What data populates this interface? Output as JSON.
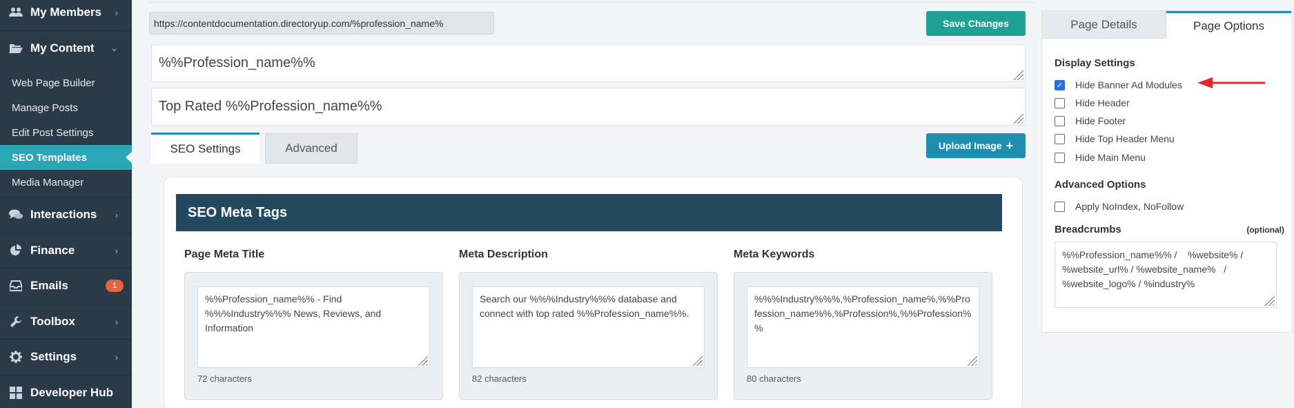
{
  "sidebar": {
    "items": [
      {
        "label": "My Members",
        "icon": "members-icon",
        "chevron": "›"
      },
      {
        "label": "My Content",
        "icon": "folder-open-icon",
        "chevron": "⌄"
      },
      {
        "label": "Interactions",
        "icon": "chat-icon",
        "chevron": "›"
      },
      {
        "label": "Finance",
        "icon": "pie-chart-icon",
        "chevron": "›"
      },
      {
        "label": "Emails",
        "icon": "inbox-icon",
        "badge": "1"
      },
      {
        "label": "Toolbox",
        "icon": "wrench-icon",
        "chevron": "›"
      },
      {
        "label": "Settings",
        "icon": "gear-icon",
        "chevron": "›"
      },
      {
        "label": "Developer Hub",
        "icon": "grid-icon"
      }
    ],
    "sub_items": [
      "Web Page Builder",
      "Manage Posts",
      "Edit Post Settings",
      "SEO Templates",
      "Media Manager"
    ],
    "active_sub": "SEO Templates"
  },
  "header": {
    "url": "https://contentdocumentation.directoryup.com/%profession_name%",
    "save_label": "Save Changes"
  },
  "fields": {
    "title_value": "%%Profession_name%%",
    "heading_value": "Top Rated %%Profession_name%%"
  },
  "tabs": {
    "seo": "SEO Settings",
    "advanced": "Advanced",
    "upload_label": "Upload Image",
    "upload_icon": "+"
  },
  "seo_meta": {
    "title": "SEO Meta Tags",
    "columns": [
      {
        "label": "Page Meta Title",
        "value": "%%Profession_name%% - Find %%%Industry%%% News, Reviews, and Information",
        "count": "72 characters"
      },
      {
        "label": "Meta Description",
        "value": "Search our %%%Industry%%% database and connect with top rated %%Profession_name%%.",
        "count": "82 characters"
      },
      {
        "label": "Meta Keywords",
        "value": "%%%Industry%%%,%Profession_name%,%%Profession_name%%,%Profession%,%%Profession%%",
        "count": "80 characters"
      }
    ]
  },
  "right_panel": {
    "tab_details": "Page Details",
    "tab_options": "Page Options",
    "display_title": "Display Settings",
    "checkboxes": [
      {
        "label": "Hide Banner Ad Modules",
        "checked": true
      },
      {
        "label": "Hide Header",
        "checked": false
      },
      {
        "label": "Hide Footer",
        "checked": false
      },
      {
        "label": "Hide Top Header Menu",
        "checked": false
      },
      {
        "label": "Hide Main Menu",
        "checked": false
      }
    ],
    "advanced_title": "Advanced Options",
    "advanced_checkbox": {
      "label": "Apply NoIndex, NoFollow",
      "checked": false
    },
    "breadcrumbs_title": "Breadcrumbs",
    "breadcrumbs_optional": "(optional)",
    "breadcrumbs_value": "%%Profession_name%% /    %website% / %website_url% / %website_name%   /      %website_logo% / %industry%"
  },
  "colors": {
    "sidebar_bg": "#2b3a49",
    "active_sub": "#2aa6b6",
    "save_button": "#1fa295",
    "upload_button": "#1e8fb0",
    "meta_bar": "#24495f",
    "annotation_arrow": "#e02b2b"
  }
}
